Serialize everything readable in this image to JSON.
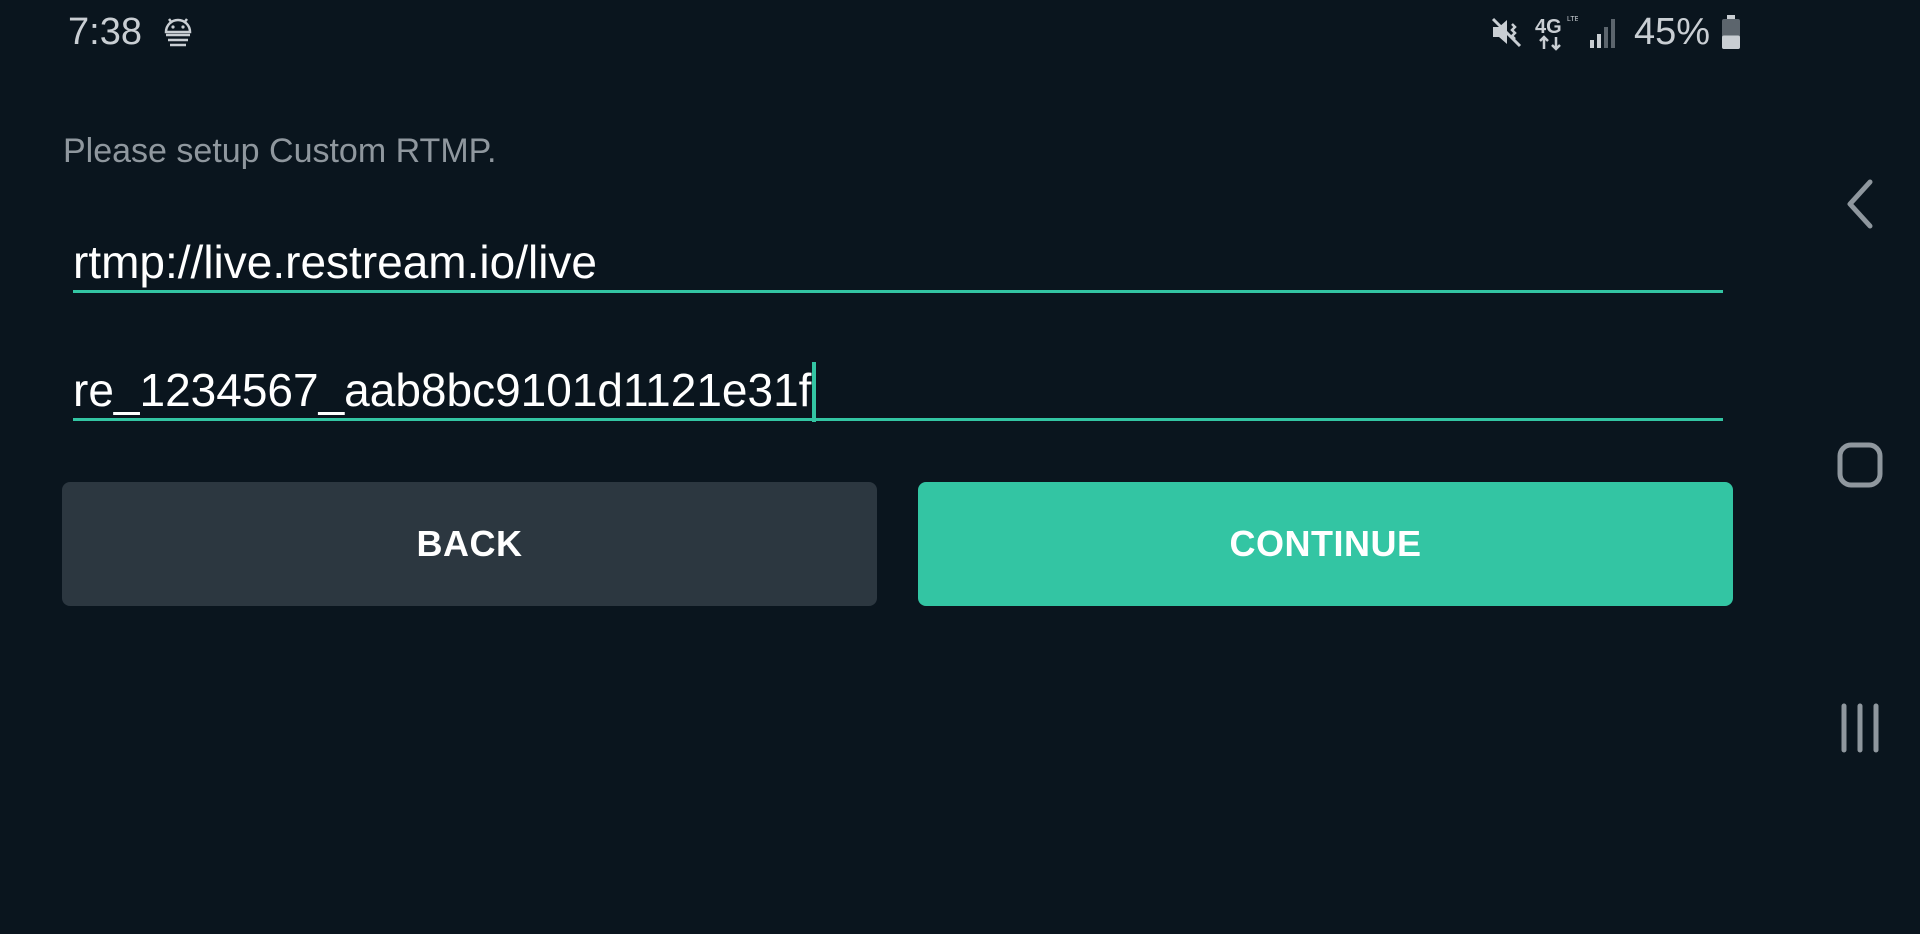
{
  "status_bar": {
    "time": "7:38",
    "left_icons": [
      "android-debug-icon"
    ],
    "right_icons": [
      "vibrate-mute-icon",
      "4g-lte-icon",
      "signal-icon",
      "battery-icon"
    ],
    "network_label": "4G",
    "battery_percent": "45%",
    "battery_level": 0.45
  },
  "setup": {
    "prompt": "Please setup Custom RTMP.",
    "server_url_value": "rtmp://live.restream.io/live",
    "stream_key_value": "re_1234567_aab8bc9101d1121e31f"
  },
  "buttons": {
    "back_label": "BACK",
    "continue_label": "CONTINUE"
  },
  "nav_bar": {
    "icons": [
      "back-icon",
      "home-icon",
      "recents-icon"
    ]
  },
  "colors": {
    "background": "#0a151e",
    "accent": "#33c5a3",
    "secondary_button": "#2c3740",
    "prompt_text": "#8f979e"
  }
}
